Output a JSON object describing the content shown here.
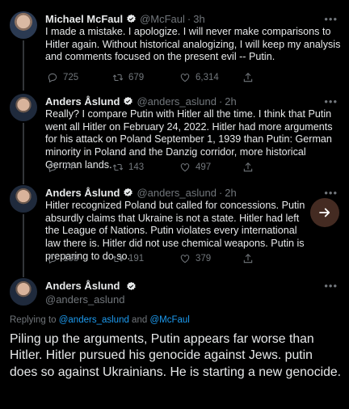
{
  "tweets": [
    {
      "name": "Michael McFaul",
      "handle": "@McFaul",
      "time": "3h",
      "text": "I made a mistake. I apologize. I will never make comparisons to Hitler again. Without historical analogizing, I will keep my analysis and comments focused on the present evil -- Putin.",
      "replies": "725",
      "retweets": "679",
      "likes": "6,314"
    },
    {
      "name": "Anders Åslund",
      "handle": "@anders_aslund",
      "time": "2h",
      "text": "Really? I compare Putin with Hitler all the time. I think that Putin went all Hitler on February 24, 2022. Hitler had more arguments for his attack on Poland September 1, 1939 than Putin: German minority in Poland and the Danzig corridor, more historical German lands.",
      "replies": "74",
      "retweets": "143",
      "likes": "497"
    },
    {
      "name": "Anders Åslund",
      "handle": "@anders_aslund",
      "time": "2h",
      "text": "Hitler recognized Poland but called for concessions. Putin absurdly claims that Ukraine is not a state. Hitler had left the League of Nations. Putin violates every international law there is. Hitler did not use chemical weapons. Putin is preparing to do so.",
      "replies": "138",
      "retweets": "191",
      "likes": "379"
    }
  ],
  "main_tweet": {
    "name": "Anders Åslund",
    "handle": "@anders_aslund",
    "replying_prefix": "Replying to ",
    "replying_user1": "@anders_aslund",
    "replying_and": " and ",
    "replying_user2": "@McFaul",
    "text": "Piling up the arguments, Putin appears far worse than Hitler. Hitler pursued his genocide against Jews. putin does so against Ukrainians. He is starting a new genocide."
  },
  "dot": "·",
  "more": "•••",
  "colors": {
    "background": "#000000",
    "accent": "#1d9bf0",
    "muted": "#71767b",
    "text": "#e7e9ea"
  },
  "icons": [
    "verified-icon",
    "reply-icon",
    "retweet-icon",
    "like-icon",
    "share-icon",
    "more-icon",
    "arrow-right-icon"
  ]
}
